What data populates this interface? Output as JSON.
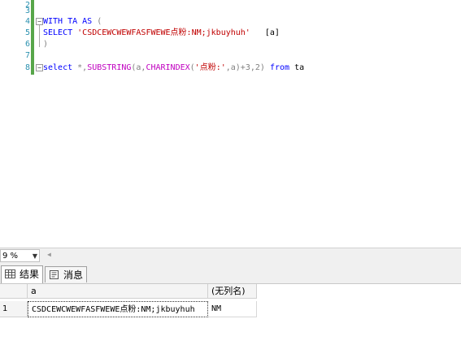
{
  "editor": {
    "line_numbers": [
      "2",
      "3",
      "4",
      "5",
      "6",
      "7",
      "8"
    ],
    "line4": {
      "kw": "WITH TA AS",
      "paren": "("
    },
    "line5": {
      "kw": "SELECT",
      "str": "'CSDCEWCWEWFASFWEWE点粉:NM;jkbuyhuh'",
      "alias": "[a]"
    },
    "line6": {
      "paren": ")"
    },
    "line8": {
      "kw_select": "select",
      "star": "*,",
      "fn_substring": "SUBSTRING",
      "p1": "(a,",
      "fn_charindex": "CHARINDEX",
      "p2": "(",
      "str": "'点粉:'",
      "p3": ",a)+3,2)",
      "kw_from": "from",
      "tbl": "ta"
    }
  },
  "status": {
    "zoom": "9 %"
  },
  "tabs": [
    {
      "label": "结果",
      "icon": "grid-icon"
    },
    {
      "label": "消息",
      "icon": "message-icon"
    }
  ],
  "results": {
    "columns": [
      "a",
      "(无列名)"
    ],
    "rows": [
      {
        "num": "1",
        "cells": [
          "CSDCEWCWEWFASFWEWE点粉:NM;jkbuyhuh",
          "NM"
        ]
      }
    ]
  }
}
